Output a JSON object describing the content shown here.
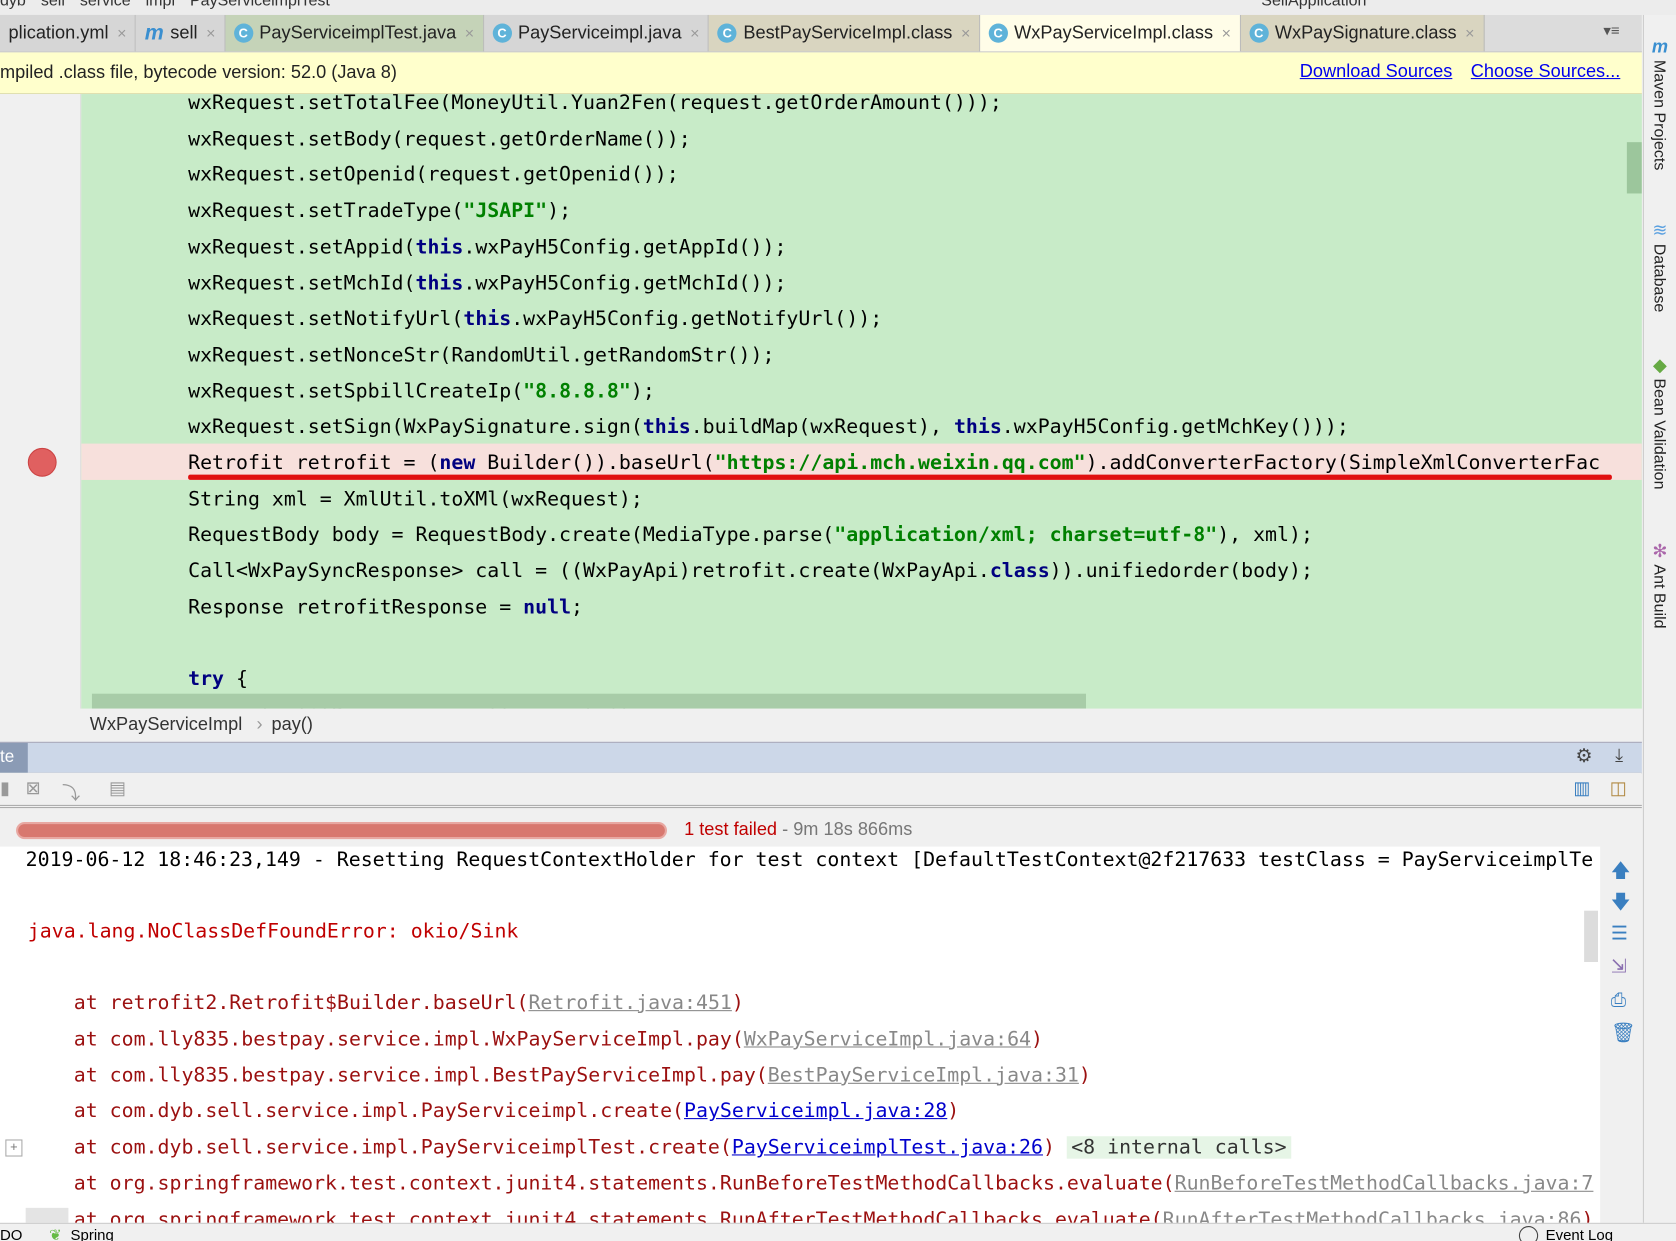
{
  "navbar": {
    "items": [
      "dyb",
      "sell",
      "service",
      "impl",
      "PayServiceimplTest"
    ],
    "run_config": "SellApplication"
  },
  "tabs": [
    {
      "label": "plication.yml",
      "icon": "yaml-icon",
      "style": "plain"
    },
    {
      "label": "sell",
      "icon": "maven-icon",
      "style": "plain"
    },
    {
      "label": "PayServiceimplTest.java",
      "icon": "C",
      "style": "green"
    },
    {
      "label": "PayServiceimpl.java",
      "icon": "C",
      "style": "plain"
    },
    {
      "label": "BestPayServiceImpl.class",
      "icon": "C",
      "style": "tan"
    },
    {
      "label": "WxPayServiceImpl.class",
      "icon": "C",
      "style": "active"
    },
    {
      "label": "WxPaySignature.class",
      "icon": "C",
      "style": "tan"
    }
  ],
  "banner": {
    "message": "mpiled .class file, bytecode version: 52.0 (Java 8)",
    "download": "Download Sources",
    "choose": "Choose Sources..."
  },
  "code_lines": [
    [
      [
        "wxRequest.setTotalFee(MoneyUtil.Yuan2Fen(request.getOrderAmount()));",
        ""
      ]
    ],
    [
      [
        "wxRequest.setBody(request.getOrderName());",
        ""
      ]
    ],
    [
      [
        "wxRequest.setOpenid(request.getOpenid());",
        ""
      ]
    ],
    [
      [
        "wxRequest.setTradeType(",
        ""
      ],
      [
        "\"JSAPI\"",
        "str"
      ],
      [
        ");",
        ""
      ]
    ],
    [
      [
        "wxRequest.setAppid(",
        ""
      ],
      [
        "this",
        "kw"
      ],
      [
        ".wxPayH5Config.getAppId());",
        ""
      ]
    ],
    [
      [
        "wxRequest.setMchId(",
        ""
      ],
      [
        "this",
        "kw"
      ],
      [
        ".wxPayH5Config.getMchId());",
        ""
      ]
    ],
    [
      [
        "wxRequest.setNotifyUrl(",
        ""
      ],
      [
        "this",
        "kw"
      ],
      [
        ".wxPayH5Config.getNotifyUrl());",
        ""
      ]
    ],
    [
      [
        "wxRequest.setNonceStr(RandomUtil.getRandomStr());",
        ""
      ]
    ],
    [
      [
        "wxRequest.setSpbillCreateIp(",
        ""
      ],
      [
        "\"8.8.8.8\"",
        "str"
      ],
      [
        ");",
        ""
      ]
    ],
    [
      [
        "wxRequest.setSign(WxPaySignature.sign(",
        ""
      ],
      [
        "this",
        "kw"
      ],
      [
        ".buildMap(wxRequest), ",
        ""
      ],
      [
        "this",
        "kw"
      ],
      [
        ".wxPayH5Config.getMchKey()));",
        ""
      ]
    ],
    [
      [
        "Retrofit retrofit = (",
        ""
      ],
      [
        "new",
        "kw"
      ],
      [
        " Builder()).baseUrl(",
        ""
      ],
      [
        "\"https://api.mch.weixin.qq.com\"",
        "str"
      ],
      [
        ").addConverterFactory(SimpleXmlConverterFac",
        ""
      ]
    ],
    [
      [
        "String xml = XmlUtil.toXMl(wxRequest);",
        ""
      ]
    ],
    [
      [
        "RequestBody body = RequestBody.create(MediaType.parse(",
        ""
      ],
      [
        "\"application/xml; charset=utf-8\"",
        "str"
      ],
      [
        "), xml);",
        ""
      ]
    ],
    [
      [
        "Call<WxPaySyncResponse> call = ((WxPayApi)retrofit.create(WxPayApi.",
        ""
      ],
      [
        "class",
        "kw"
      ],
      [
        ")).unifiedorder(body);",
        ""
      ]
    ],
    [
      [
        "Response retrofitResponse = ",
        ""
      ],
      [
        "null",
        "kw"
      ],
      [
        ";",
        ""
      ]
    ],
    [],
    [
      [
        "try",
        "kw"
      ],
      [
        " {",
        ""
      ]
    ],
    [
      [
        "    retrofitResponse = call.execute();",
        ""
      ]
    ]
  ],
  "breadcrumb": {
    "class": "WxPayServiceImpl",
    "method": "pay()"
  },
  "right_tools": [
    "Maven Projects",
    "Database",
    "Bean Validation",
    "Ant Build"
  ],
  "panel": {
    "tab": "te"
  },
  "test_status": {
    "failed": "1 test failed",
    "duration": " - 9m 18s 866ms",
    "progress": 1.0,
    "color": "#d8786f"
  },
  "console": {
    "log": "2019-06-12 18:46:23,149 - Resetting RequestContextHolder for test context [DefaultTestContext@2f217633 testClass = PayServiceimplTe",
    "error": "java.lang.NoClassDefFoundError: okio/Sink",
    "frames": [
      {
        "text": "at retrofit2.Retrofit$Builder.baseUrl(",
        "link": "Retrofit.java:451",
        "linkstyle": "grey",
        "tail": ")"
      },
      {
        "text": "at com.lly835.bestpay.service.impl.WxPayServiceImpl.pay(",
        "link": "WxPayServiceImpl.java:64",
        "linkstyle": "grey",
        "tail": ")"
      },
      {
        "text": "at com.lly835.bestpay.service.impl.BestPayServiceImpl.pay(",
        "link": "BestPayServiceImpl.java:31",
        "linkstyle": "grey",
        "tail": ")"
      },
      {
        "text": "at com.dyb.sell.service.impl.PayServiceimpl.create(",
        "link": "PayServiceimpl.java:28",
        "linkstyle": "blue",
        "tail": ")"
      },
      {
        "text": "at com.dyb.sell.service.impl.PayServiceimplTest.create(",
        "link": "PayServiceimplTest.java:26",
        "linkstyle": "blue",
        "tail": ") ",
        "internal": "<8 internal calls>"
      },
      {
        "text": "at org.springframework.test.context.junit4.statements.RunBeforeTestMethodCallbacks.evaluate(",
        "link": "RunBeforeTestMethodCallbacks.java:7",
        "linkstyle": "grey",
        "tail": ""
      },
      {
        "text": "at org.springframework.test.context.junit4.statements.RunAfterTestMethodCallbacks.evaluate(",
        "link": "RunAfterTestMethodCallbacks.java:86",
        "linkstyle": "grey",
        "tail": ")"
      }
    ]
  },
  "statusbar": {
    "left": "DO",
    "spring": "Spring",
    "event_log": "Event Log"
  }
}
